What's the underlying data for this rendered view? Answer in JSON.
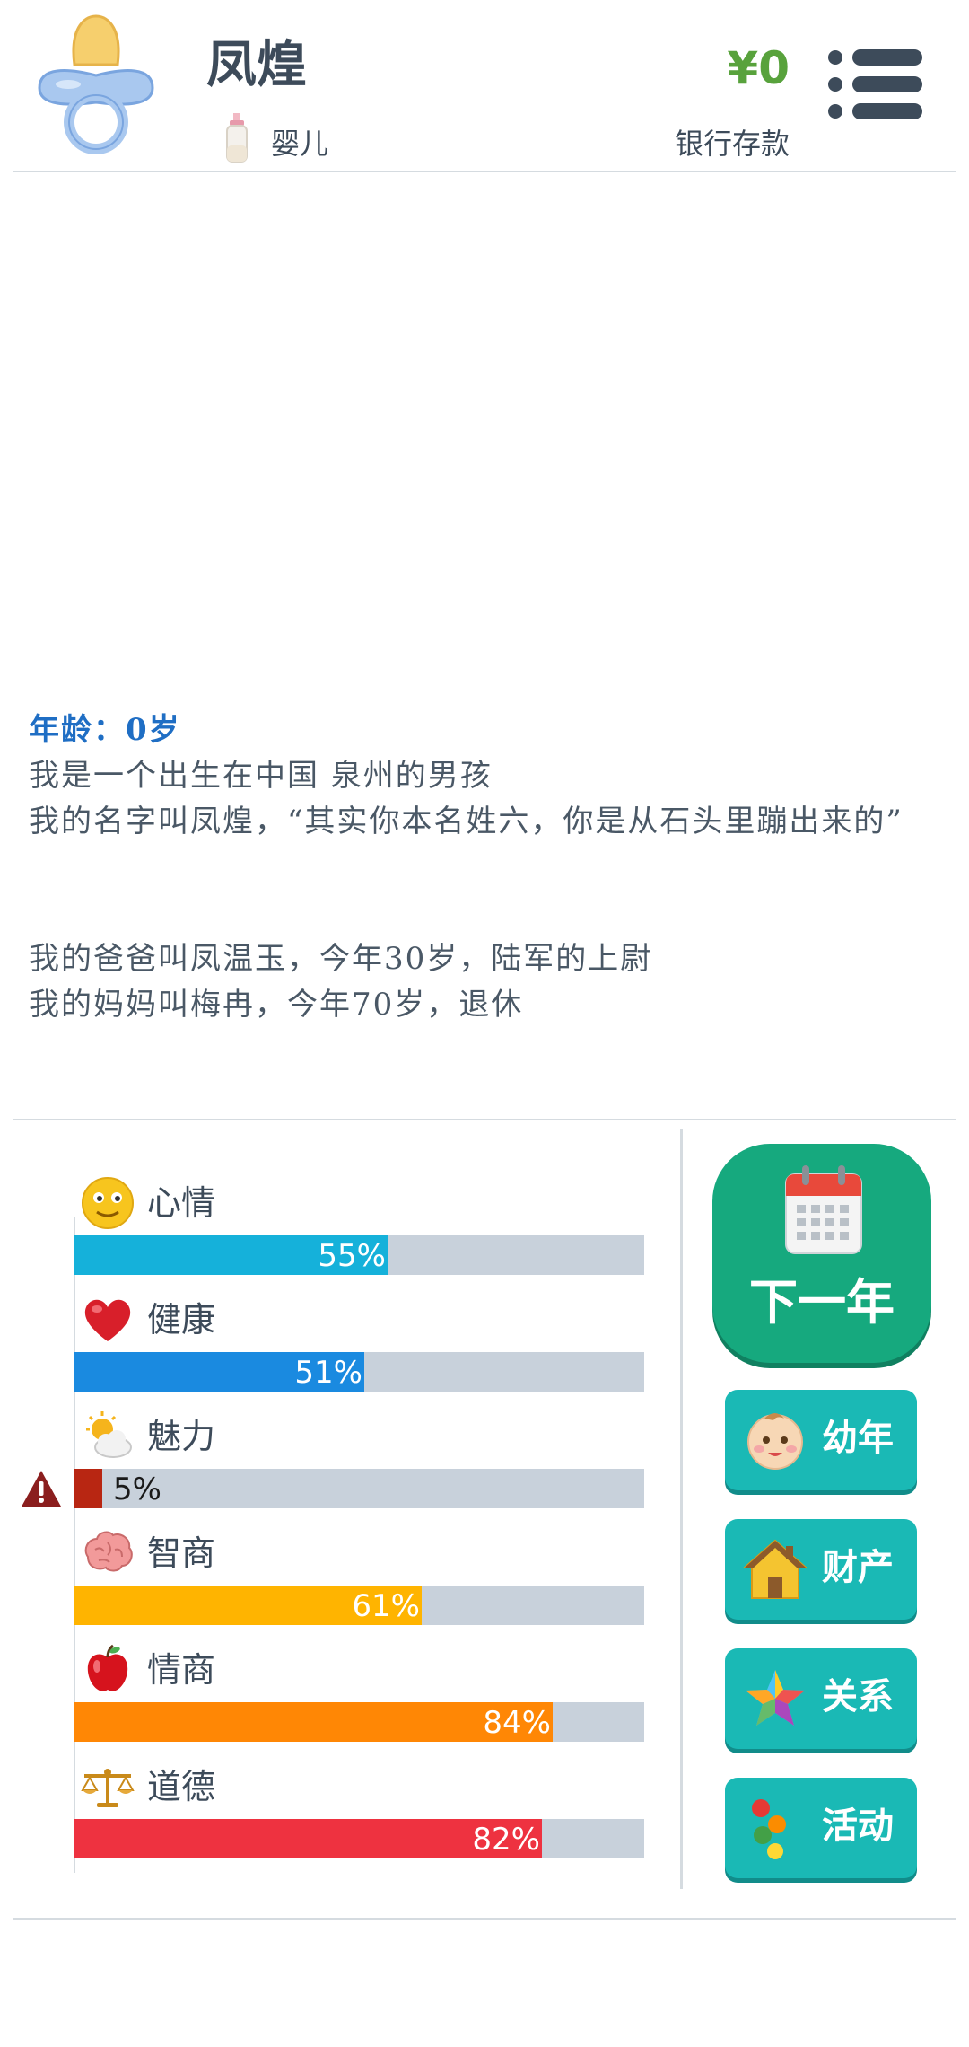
{
  "header": {
    "name": "凤煌",
    "stage": "婴儿",
    "money": "¥0",
    "bank_label": "银行存款"
  },
  "story": {
    "age_line": "年龄：0岁",
    "lines_group1": [
      "我是一个出生在中国 泉州的男孩",
      "我的名字叫凤煌，“其实你本名姓六，你是从石头里蹦出来的”"
    ],
    "lines_group2": [
      "我的爸爸叫凤温玉，今年30岁，陆军的上尉",
      "我的妈妈叫梅冉，今年70岁，退休"
    ]
  },
  "stats": [
    {
      "label": "心情",
      "value": 55,
      "pct_text": "55%",
      "color": "#15b1da",
      "icon": "smiley-icon"
    },
    {
      "label": "健康",
      "value": 51,
      "pct_text": "51%",
      "color": "#1a8ae0",
      "icon": "heart-icon"
    },
    {
      "label": "魅力",
      "value": 5,
      "pct_text": "5%",
      "color": "#b82612",
      "icon": "sun-cloud-icon",
      "warning": true
    },
    {
      "label": "智商",
      "value": 61,
      "pct_text": "61%",
      "color": "#ffb400",
      "icon": "brain-icon"
    },
    {
      "label": "情商",
      "value": 84,
      "pct_text": "84%",
      "color": "#ff8705",
      "icon": "apple-icon"
    },
    {
      "label": "道德",
      "value": 82,
      "pct_text": "82%",
      "color": "#ee3240",
      "icon": "scales-icon"
    }
  ],
  "buttons": {
    "next_year": "下一年",
    "childhood": "幼年",
    "assets": "财产",
    "relations": "关系",
    "activities": "活动"
  },
  "colors": {
    "primary_green": "#16a97e",
    "side_button": "#1ab9b5",
    "money_green": "#58a23c",
    "age_blue": "#1f6ec4"
  }
}
